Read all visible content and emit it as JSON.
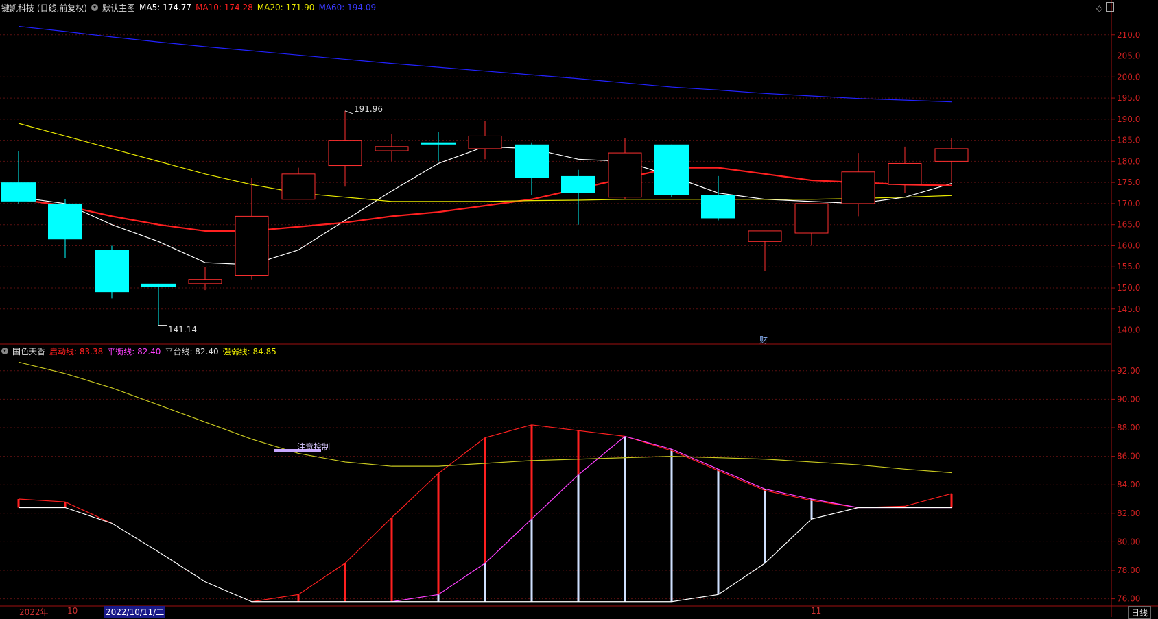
{
  "header": {
    "stock": "键凯科技 (日线,前复权)",
    "main_chart_label": "默认主图",
    "ma5": "MA5: 174.77",
    "ma10": "MA10: 174.28",
    "ma20": "MA20: 171.90",
    "ma60": "MA60: 194.09",
    "colors": {
      "ma5": "#ffffff",
      "ma10": "#ff2020",
      "ma20": "#e8e800",
      "ma60": "#2222ff"
    }
  },
  "indicator_header": {
    "name": "国色天香",
    "qidong": "启动线: 83.38",
    "pingheng": "平衡线: 82.40",
    "pingtai": "平台线: 82.40",
    "qiangruo": "强弱线: 84.85"
  },
  "annotations": {
    "high_label": "191.96",
    "low_label": "141.14",
    "cai_marker": "财",
    "note": "注意控制"
  },
  "bottom": {
    "year": "2022年",
    "m10": "10",
    "date": "2022/10/11/二",
    "m11": "11",
    "period": "日线"
  },
  "chart_data": [
    {
      "type": "candlestick",
      "ylim": [
        137,
        215
      ],
      "y_ticks": [
        140,
        145,
        150,
        155,
        160,
        165,
        170,
        175,
        180,
        185,
        190,
        195,
        200,
        205,
        210
      ],
      "candles": [
        {
          "o": 175.0,
          "h": 182.5,
          "l": 170.0,
          "c": 170.5
        },
        {
          "o": 170.0,
          "h": 171.0,
          "l": 157.0,
          "c": 161.5
        },
        {
          "o": 159.0,
          "h": 160.0,
          "l": 147.5,
          "c": 149.0
        },
        {
          "o": 151.0,
          "h": 151.0,
          "l": 141.14,
          "c": 150.2
        },
        {
          "o": 151.0,
          "h": 155.0,
          "l": 149.5,
          "c": 152.0
        },
        {
          "o": 153.0,
          "h": 176.0,
          "l": 152.0,
          "c": 167.0
        },
        {
          "o": 171.0,
          "h": 178.5,
          "l": 171.0,
          "c": 177.0
        },
        {
          "o": 179.0,
          "h": 191.96,
          "l": 174.0,
          "c": 185.0
        },
        {
          "o": 182.5,
          "h": 186.5,
          "l": 180.0,
          "c": 183.5
        },
        {
          "o": 184.5,
          "h": 187.0,
          "l": 180.0,
          "c": 184.0
        },
        {
          "o": 183.0,
          "h": 189.5,
          "l": 180.5,
          "c": 186.0
        },
        {
          "o": 184.0,
          "h": 184.5,
          "l": 172.0,
          "c": 176.0
        },
        {
          "o": 176.5,
          "h": 178.0,
          "l": 165.0,
          "c": 172.5
        },
        {
          "o": 171.5,
          "h": 185.5,
          "l": 171.0,
          "c": 182.0
        },
        {
          "o": 184.0,
          "h": 184.0,
          "l": 171.5,
          "c": 172.0
        },
        {
          "o": 172.0,
          "h": 176.5,
          "l": 166.0,
          "c": 166.5
        },
        {
          "o": 161.0,
          "h": 163.5,
          "l": 154.0,
          "c": 163.5
        },
        {
          "o": 163.0,
          "h": 170.0,
          "l": 160.0,
          "c": 170.0
        },
        {
          "o": 170.0,
          "h": 182.0,
          "l": 167.0,
          "c": 177.5
        },
        {
          "o": 174.5,
          "h": 183.5,
          "l": 172.5,
          "c": 179.5
        },
        {
          "o": 180.0,
          "h": 185.5,
          "l": 175.0,
          "c": 183.0
        }
      ],
      "series": [
        {
          "name": "MA5",
          "color": "#ffffff",
          "values": [
            171.5,
            170.0,
            165.0,
            161.0,
            156.0,
            155.5,
            159.0,
            166.0,
            173.0,
            179.5,
            183.5,
            183.0,
            180.5,
            180.0,
            176.5,
            172.5,
            171.0,
            170.5,
            170.0,
            171.5,
            174.77
          ]
        },
        {
          "name": "MA10",
          "color": "#ff2020",
          "values": [
            171.0,
            169.5,
            167.0,
            165.0,
            163.5,
            163.5,
            164.5,
            165.5,
            167.0,
            168.0,
            169.5,
            171.0,
            173.5,
            176.0,
            178.5,
            178.5,
            177.0,
            175.5,
            175.0,
            174.5,
            174.28
          ]
        },
        {
          "name": "MA20",
          "color": "#e8e800",
          "values": [
            189.0,
            186.0,
            183.0,
            180.0,
            177.0,
            174.5,
            172.5,
            171.5,
            170.5,
            170.5,
            170.5,
            170.7,
            170.8,
            171.0,
            171.0,
            171.0,
            171.0,
            171.0,
            171.2,
            171.5,
            171.9
          ]
        },
        {
          "name": "MA60",
          "color": "#2222ff",
          "values": [
            212.0,
            210.8,
            209.5,
            208.3,
            207.2,
            206.2,
            205.2,
            204.2,
            203.2,
            202.3,
            201.4,
            200.5,
            199.6,
            198.6,
            197.6,
            196.9,
            196.1,
            195.5,
            194.9,
            194.5,
            194.09
          ]
        }
      ]
    },
    {
      "type": "line",
      "ylim": [
        75.5,
        93
      ],
      "y_ticks": [
        76,
        78,
        80,
        82,
        84,
        86,
        88,
        90,
        92
      ],
      "series": [
        {
          "name": "启动线",
          "color": "#ff2020",
          "values": [
            83.0,
            82.8,
            81.3,
            null,
            null,
            75.8,
            76.3,
            78.5,
            81.7,
            84.8,
            87.3,
            88.2,
            87.8,
            87.4,
            86.4,
            85.0,
            83.6,
            82.9,
            82.4,
            82.5,
            83.38
          ]
        },
        {
          "name": "平衡线",
          "color": "#ff40ff",
          "values": [
            null,
            null,
            null,
            null,
            null,
            null,
            null,
            null,
            75.8,
            76.3,
            78.5,
            81.6,
            84.7,
            87.4,
            86.5,
            85.1,
            83.7,
            83.0,
            82.4,
            82.4,
            82.4
          ]
        },
        {
          "name": "平台线",
          "color": "#ffffff",
          "values": [
            82.4,
            82.4,
            81.3,
            79.3,
            77.2,
            75.8,
            75.8,
            75.8,
            75.8,
            75.8,
            75.8,
            75.8,
            75.8,
            75.8,
            75.8,
            76.3,
            78.5,
            81.6,
            82.4,
            82.4,
            82.4
          ]
        },
        {
          "name": "强弱线",
          "color": "#c8c820",
          "values": [
            92.6,
            91.8,
            90.8,
            89.6,
            88.4,
            87.2,
            86.2,
            85.6,
            85.3,
            85.3,
            85.5,
            85.7,
            85.8,
            85.9,
            86.0,
            85.9,
            85.8,
            85.6,
            85.4,
            85.1,
            84.85
          ]
        }
      ],
      "bars": [
        {
          "i": 0,
          "top": 83.0,
          "bottom": 82.4,
          "color": "#ff2020"
        },
        {
          "i": 1,
          "top": 82.8,
          "bottom": 82.4,
          "color": "#ff2020"
        },
        {
          "i": 6,
          "top": 76.3,
          "bottom": 75.8,
          "color": "#ff2020"
        },
        {
          "i": 7,
          "top": 78.5,
          "bottom": 75.8,
          "color": "#ff2020"
        },
        {
          "i": 8,
          "top": 81.7,
          "bottom": 75.8,
          "color": "#ff2020"
        },
        {
          "i": 9,
          "top": 84.8,
          "bottom": 76.3,
          "color": "#ff2020"
        },
        {
          "i": 10,
          "top": 87.3,
          "bottom": 78.5,
          "color": "#ff2020"
        },
        {
          "i": 11,
          "top": 88.2,
          "bottom": 81.6,
          "color": "#ff2020"
        },
        {
          "i": 12,
          "top": 87.8,
          "bottom": 84.7,
          "color": "#ff2020"
        },
        {
          "i": 9,
          "top": 76.3,
          "bottom": 75.8,
          "color": "#cfe0ff"
        },
        {
          "i": 10,
          "top": 78.5,
          "bottom": 75.8,
          "color": "#cfe0ff"
        },
        {
          "i": 11,
          "top": 81.6,
          "bottom": 75.8,
          "color": "#cfe0ff"
        },
        {
          "i": 12,
          "top": 84.7,
          "bottom": 75.8,
          "color": "#cfe0ff"
        },
        {
          "i": 13,
          "top": 87.4,
          "bottom": 75.8,
          "color": "#cfe0ff"
        },
        {
          "i": 14,
          "top": 86.5,
          "bottom": 75.8,
          "color": "#cfe0ff"
        },
        {
          "i": 15,
          "top": 85.1,
          "bottom": 76.3,
          "color": "#cfe0ff"
        },
        {
          "i": 16,
          "top": 83.7,
          "bottom": 78.5,
          "color": "#cfe0ff"
        },
        {
          "i": 17,
          "top": 83.0,
          "bottom": 81.6,
          "color": "#cfe0ff"
        },
        {
          "i": 20,
          "top": 83.38,
          "bottom": 82.4,
          "color": "#ff2020"
        }
      ]
    }
  ]
}
